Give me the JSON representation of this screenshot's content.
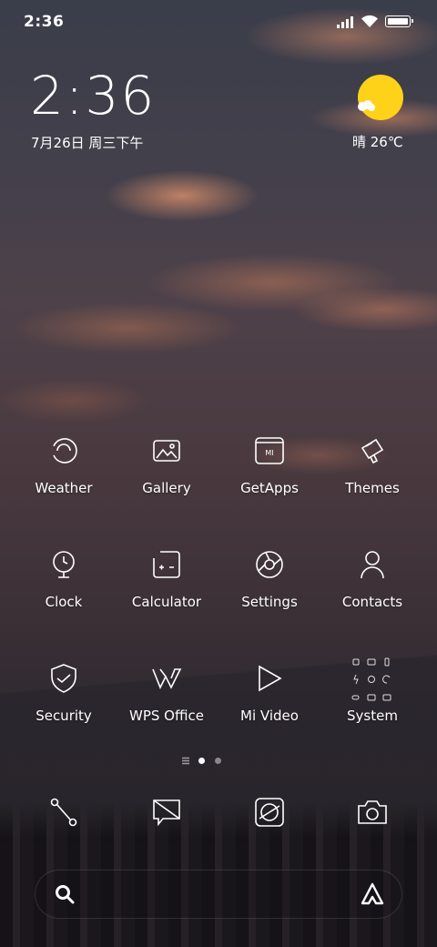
{
  "status_bar": {
    "time": "2:36"
  },
  "clock_widget": {
    "time": "2:36",
    "date": "7月26日 周三下午"
  },
  "weather_widget": {
    "text": "晴 26℃",
    "sun_color": "#ffd21a"
  },
  "apps": [
    {
      "label": "Weather",
      "icon": "weather-icon"
    },
    {
      "label": "Gallery",
      "icon": "gallery-icon"
    },
    {
      "label": "GetApps",
      "icon": "getapps-icon"
    },
    {
      "label": "Themes",
      "icon": "themes-icon"
    },
    {
      "label": "Clock",
      "icon": "clock-icon"
    },
    {
      "label": "Calculator",
      "icon": "calculator-icon"
    },
    {
      "label": "Settings",
      "icon": "settings-icon"
    },
    {
      "label": "Contacts",
      "icon": "contacts-icon"
    },
    {
      "label": "Security",
      "icon": "security-icon"
    },
    {
      "label": "WPS Office",
      "icon": "wps-office-icon"
    },
    {
      "label": "Mi Video",
      "icon": "mi-video-icon"
    },
    {
      "label": "System",
      "icon": "system-folder-icon"
    }
  ],
  "getapps_badge": "MI",
  "pager": {
    "pages": 2,
    "current": 1
  },
  "dock": [
    "phone-icon",
    "messages-icon",
    "browser-icon",
    "camera-icon"
  ],
  "search_bar": {
    "icons": [
      "search-icon",
      "assistant-icon"
    ]
  }
}
